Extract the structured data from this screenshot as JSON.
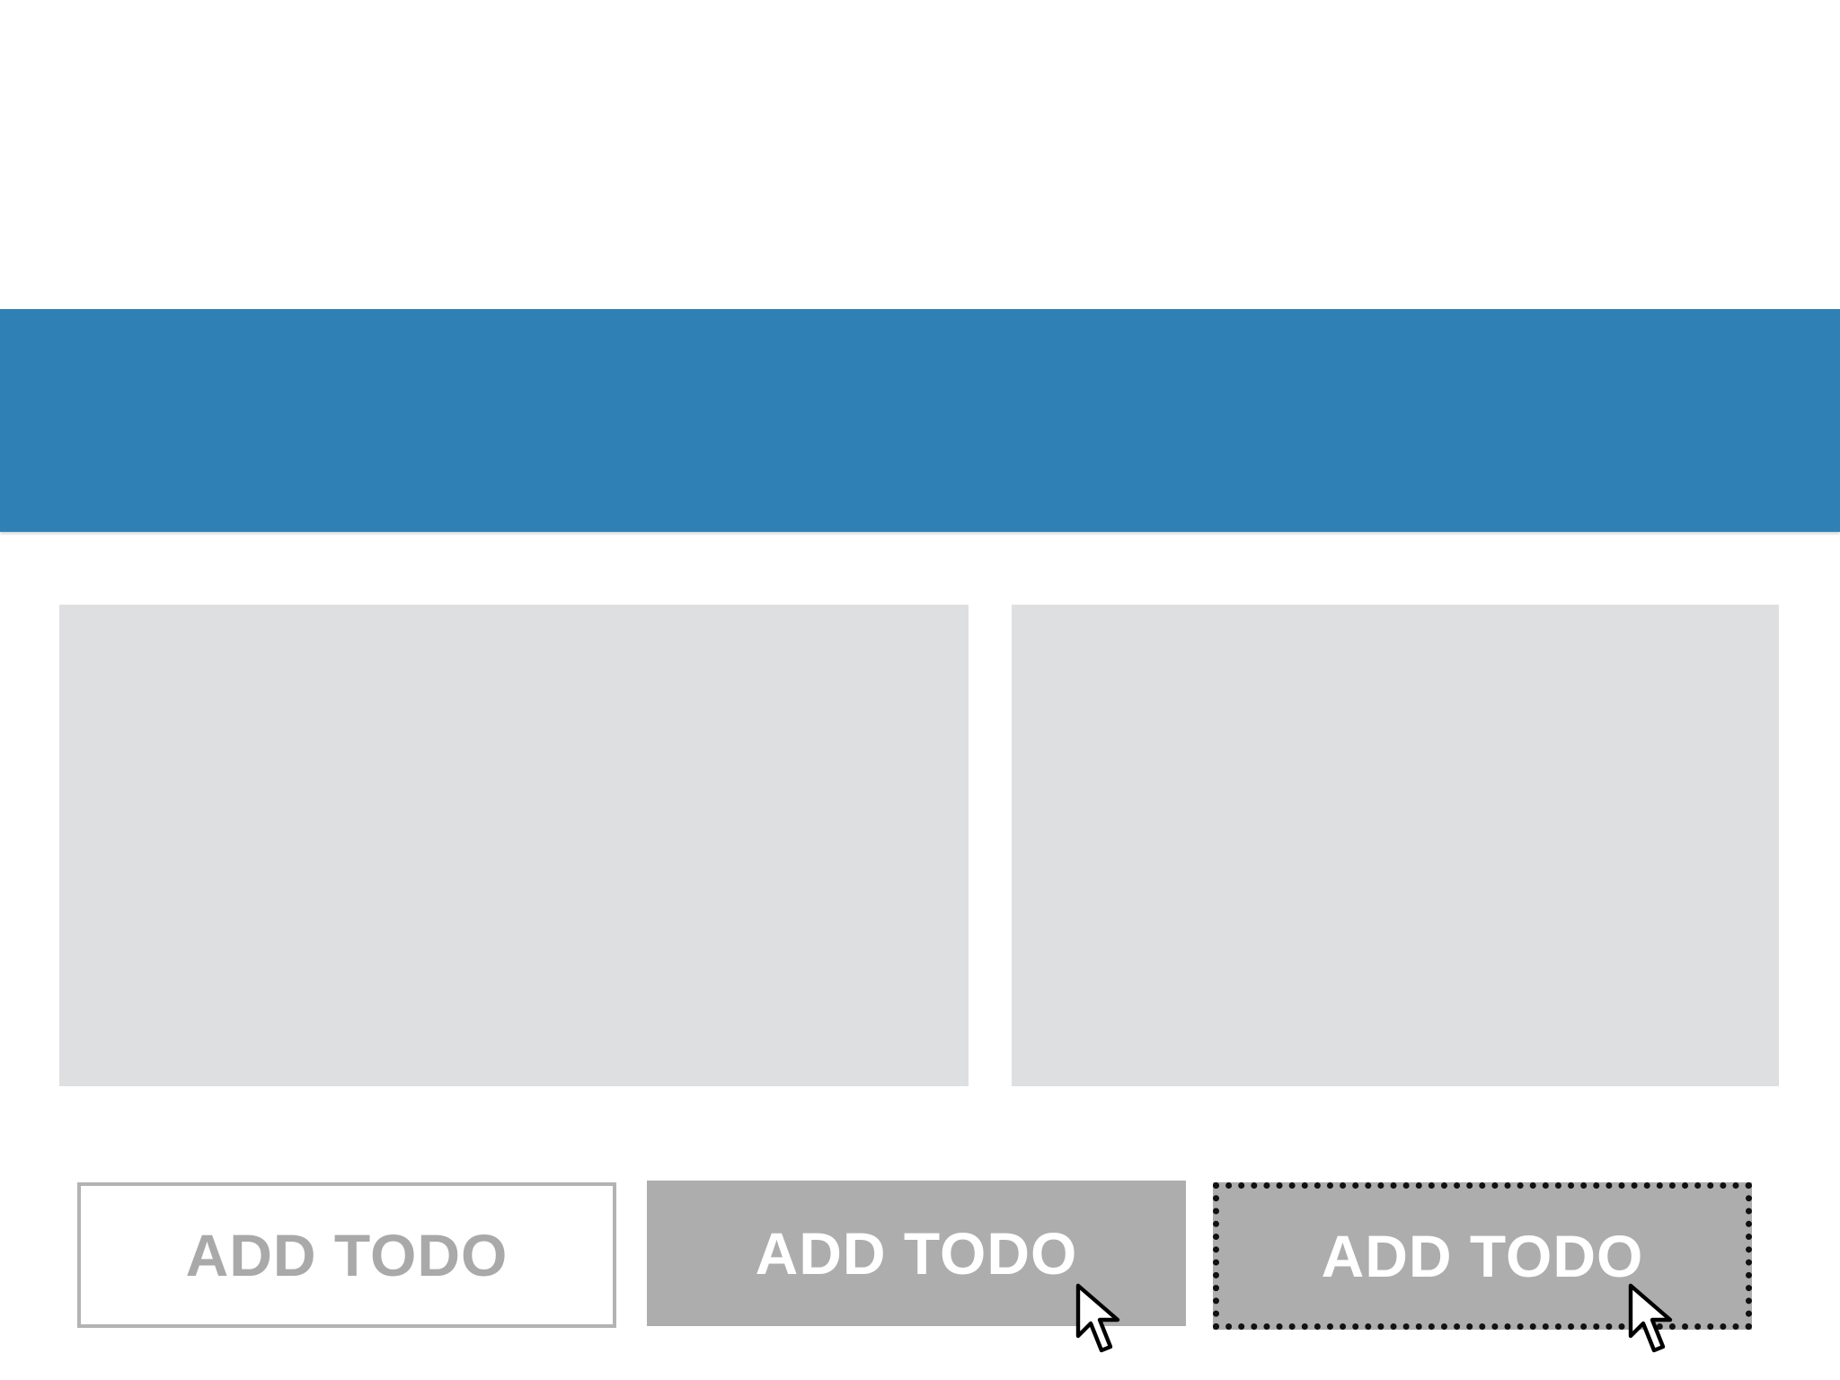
{
  "colors": {
    "header_bar": "#2f80b4",
    "panel": "#dedfe1",
    "button_normal_border": "#b3b3b3",
    "button_normal_text": "#a9a9a9",
    "button_active_bg": "#adadad",
    "button_active_text": "#ffffff",
    "focus_outline": "#111111"
  },
  "buttons": {
    "normal_label": "ADD TODO",
    "hover_label": "ADD TODO",
    "focus_label": "ADD TODO"
  },
  "icons": {
    "cursor": "mouse-pointer-arrow-icon"
  }
}
